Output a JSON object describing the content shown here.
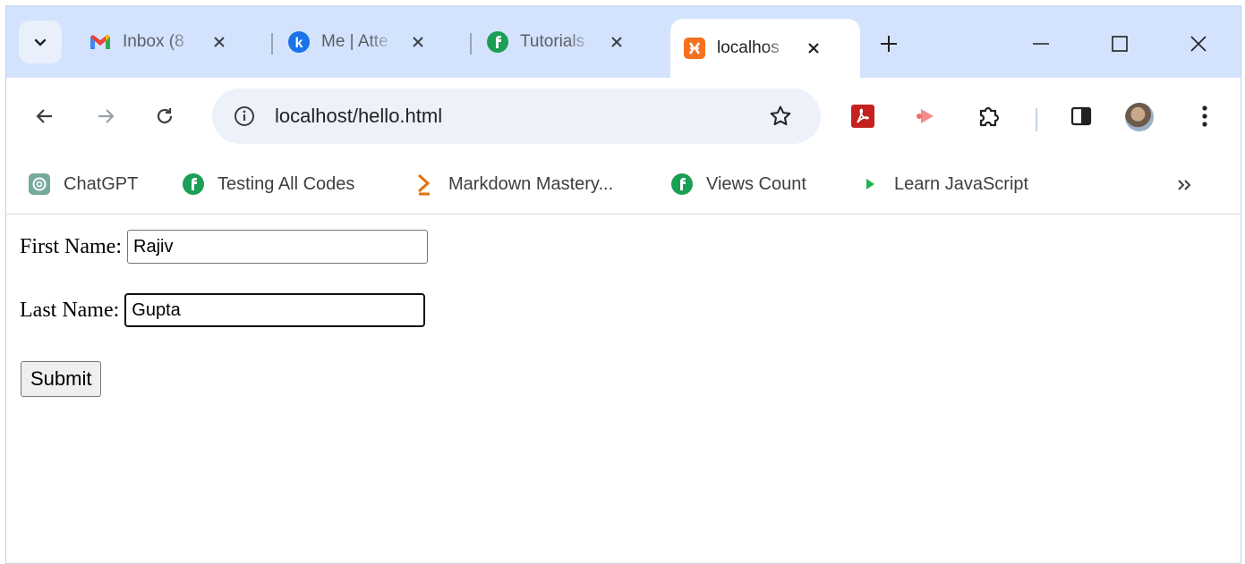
{
  "tabs": [
    {
      "title": "Inbox (8",
      "favicon": "gmail-icon"
    },
    {
      "title": "Me | Atte",
      "favicon": "k-logo-icon"
    },
    {
      "title": "Tutorials",
      "favicon": "tutorial-logo-icon"
    },
    {
      "title": "localhos",
      "favicon": "xampp-icon",
      "active": true
    }
  ],
  "toolbar": {
    "url": "localhost/hello.html"
  },
  "bookmarks": [
    {
      "label": "ChatGPT",
      "favicon": "chatgpt-icon"
    },
    {
      "label": "Testing All Codes",
      "favicon": "tutorial-logo-icon"
    },
    {
      "label": "Markdown Mastery...",
      "favicon": "chevron-orange-icon"
    },
    {
      "label": "Views Count",
      "favicon": "tutorial-logo-icon"
    },
    {
      "label": "Learn JavaScript",
      "favicon": "play-green-icon"
    }
  ],
  "form": {
    "first_name_label": "First Name:",
    "first_name_value": "Rajiv",
    "last_name_label": "Last Name:",
    "last_name_value": "Gupta",
    "submit_label": "Submit"
  },
  "colors": {
    "tabstrip_bg": "#d3e3fd",
    "omnibox_bg": "#edf2fa",
    "tutorial_green": "#1a9f54",
    "pdf_red": "#c5221f"
  }
}
